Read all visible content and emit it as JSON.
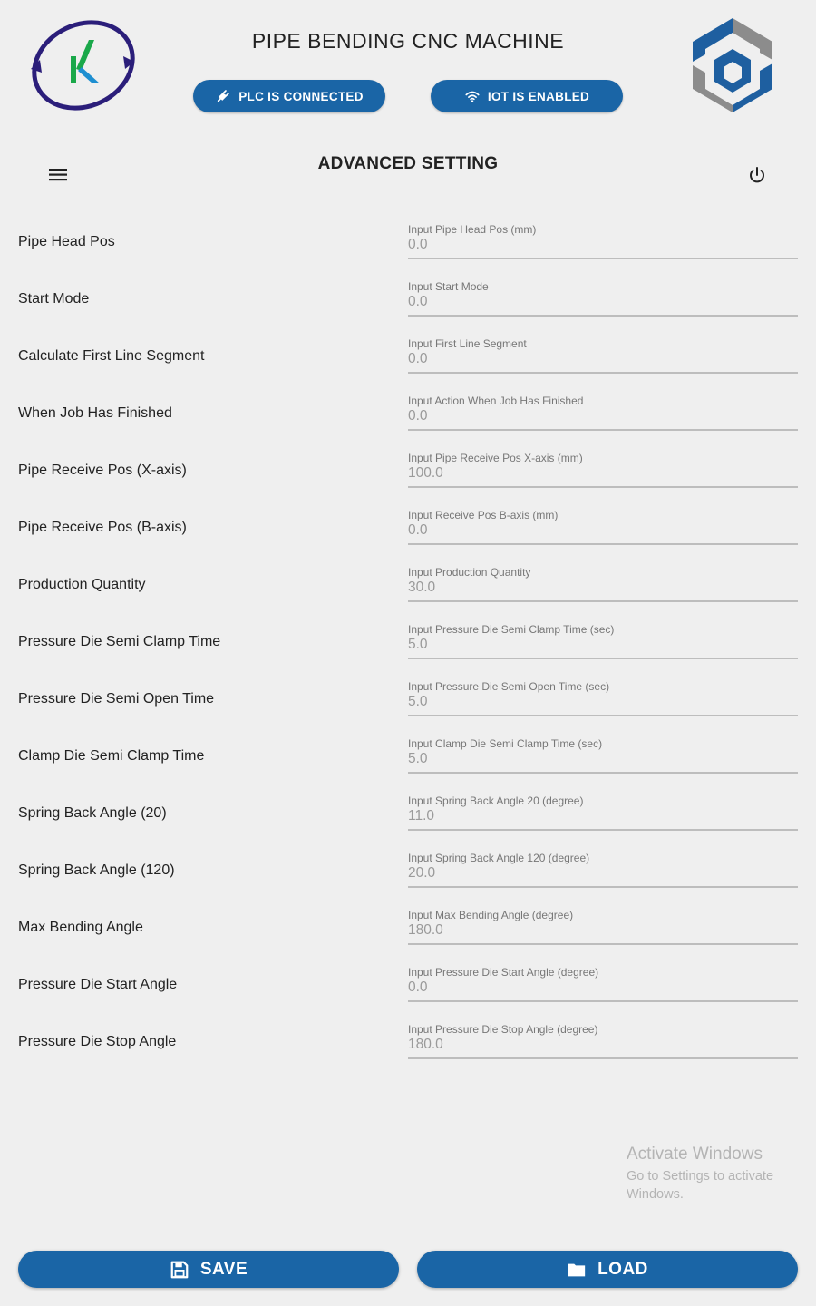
{
  "header": {
    "title": "PIPE BENDING CNC MACHINE",
    "plc_status": "PLC IS CONNECTED",
    "iot_status": "IOT IS ENABLED"
  },
  "page": {
    "title": "ADVANCED SETTING"
  },
  "icons": {
    "menu": "menu-icon",
    "power": "power-icon",
    "plc": "plug-icon",
    "iot": "wifi-icon",
    "save": "floppy-disk-icon",
    "load": "folder-icon"
  },
  "settings": [
    {
      "label": "Pipe Head Pos",
      "caption": "Input Pipe Head Pos (mm)",
      "value": "0.0"
    },
    {
      "label": "Start Mode",
      "caption": "Input Start Mode",
      "value": "0.0"
    },
    {
      "label": "Calculate First Line Segment",
      "caption": "Input First Line Segment",
      "value": "0.0"
    },
    {
      "label": "When Job Has Finished",
      "caption": "Input Action When Job Has Finished",
      "value": "0.0"
    },
    {
      "label": "Pipe Receive Pos (X-axis)",
      "caption": "Input Pipe Receive Pos X-axis (mm)",
      "value": "100.0"
    },
    {
      "label": "Pipe Receive Pos (B-axis)",
      "caption": "Input Receive Pos B-axis (mm)",
      "value": "0.0"
    },
    {
      "label": "Production Quantity",
      "caption": "Input Production Quantity",
      "value": "30.0"
    },
    {
      "label": "Pressure Die Semi Clamp Time",
      "caption": "Input Pressure Die Semi Clamp Time (sec)",
      "value": "5.0"
    },
    {
      "label": "Pressure Die Semi Open Time",
      "caption": "Input Pressure Die Semi Open Time (sec)",
      "value": "5.0"
    },
    {
      "label": "Clamp Die Semi Clamp Time",
      "caption": "Input Clamp Die Semi Clamp Time (sec)",
      "value": "5.0"
    },
    {
      "label": "Spring Back Angle (20)",
      "caption": "Input Spring Back Angle 20 (degree)",
      "value": "11.0"
    },
    {
      "label": "Spring Back Angle (120)",
      "caption": "Input Spring Back Angle 120 (degree)",
      "value": "20.0"
    },
    {
      "label": "Max Bending Angle",
      "caption": "Input Max Bending Angle (degree)",
      "value": "180.0"
    },
    {
      "label": "Pressure Die Start Angle",
      "caption": "Input Pressure Die Start Angle (degree)",
      "value": "0.0"
    },
    {
      "label": "Pressure Die Stop Angle",
      "caption": "Input Pressure Die Stop Angle (degree)",
      "value": "180.0"
    }
  ],
  "watermark": {
    "title": "Activate Windows",
    "subtitle": "Go to Settings to activate Windows."
  },
  "footer": {
    "save_label": "SAVE",
    "load_label": "LOAD"
  },
  "colors": {
    "accent": "#1a65a6",
    "background": "#efefef",
    "logo_blue": "#1e5fa0",
    "logo_gray": "#8c8c8c"
  }
}
